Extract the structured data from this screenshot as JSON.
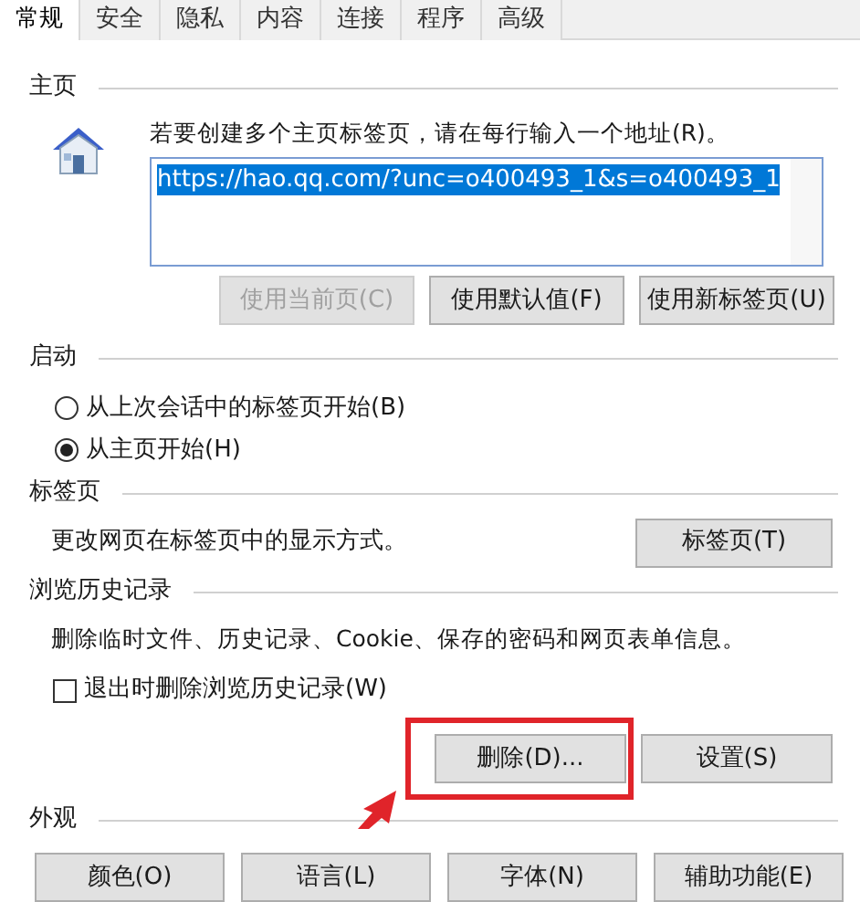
{
  "tabs": [
    {
      "label": "常规",
      "selected": true
    },
    {
      "label": "安全",
      "selected": false
    },
    {
      "label": "隐私",
      "selected": false
    },
    {
      "label": "内容",
      "selected": false
    },
    {
      "label": "连接",
      "selected": false
    },
    {
      "label": "程序",
      "selected": false
    },
    {
      "label": "高级",
      "selected": false
    }
  ],
  "homepage": {
    "heading": "主页",
    "instruction": "若要创建多个主页标签页，请在每行输入一个地址(R)。",
    "value": "https://hao.qq.com/?unc=o400493_1&s=o400493_1",
    "buttons": [
      {
        "label": "使用当前页(C)",
        "disabled": true
      },
      {
        "label": "使用默认值(F)",
        "disabled": false
      },
      {
        "label": "使用新标签页(U)",
        "disabled": false
      }
    ]
  },
  "startup": {
    "heading": "启动",
    "options": [
      {
        "label": "从上次会话中的标签页开始(B)",
        "selected": false
      },
      {
        "label": "从主页开始(H)",
        "selected": true
      }
    ]
  },
  "tabs_section": {
    "heading": "标签页",
    "description": "更改网页在标签页中的显示方式。",
    "button": "标签页(T)"
  },
  "history": {
    "heading": "浏览历史记录",
    "description": "删除临时文件、历史记录、Cookie、保存的密码和网页表单信息。",
    "checkbox": {
      "label": "退出时删除浏览历史记录(W)",
      "checked": false
    },
    "buttons": [
      {
        "label": "删除(D)...",
        "highlighted": true
      },
      {
        "label": "设置(S)",
        "highlighted": false
      }
    ]
  },
  "appearance": {
    "heading": "外观",
    "buttons": [
      "颜色(O)",
      "语言(L)",
      "字体(N)",
      "辅助功能(E)"
    ]
  }
}
